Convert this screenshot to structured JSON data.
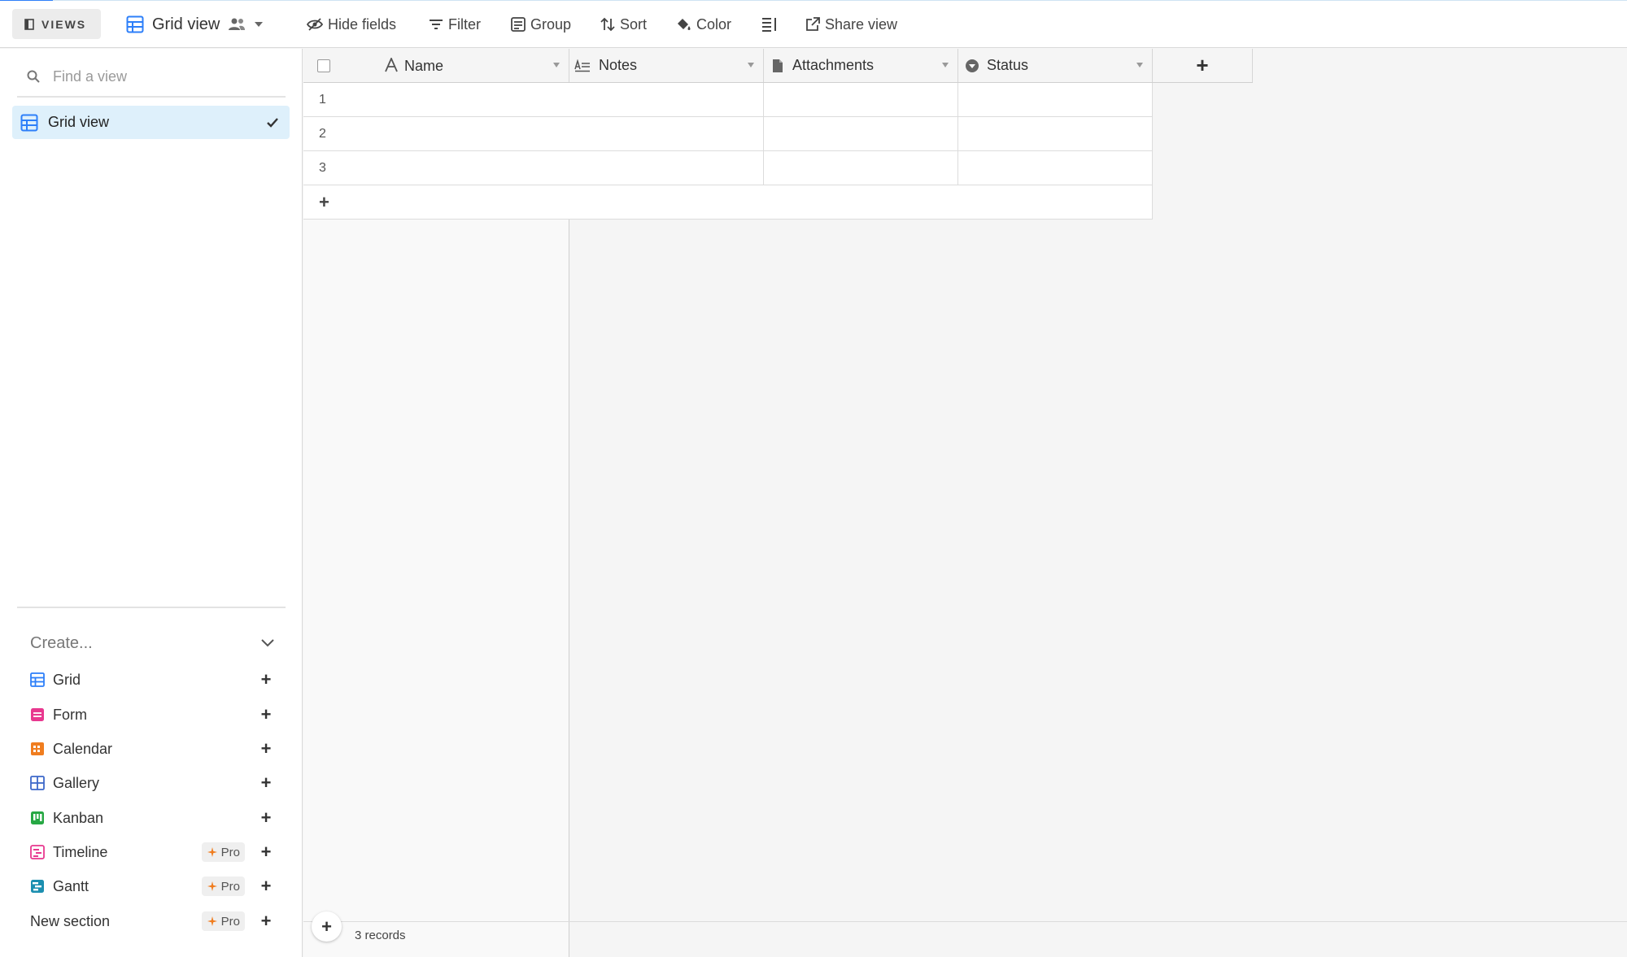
{
  "toolbar": {
    "views_label": "VIEWS",
    "current_view": "Grid view",
    "hide_fields": "Hide fields",
    "filter": "Filter",
    "group": "Group",
    "sort": "Sort",
    "color": "Color",
    "share_view": "Share view"
  },
  "sidebar": {
    "search_placeholder": "Find a view",
    "views": [
      {
        "label": "Grid view",
        "selected": true,
        "icon": "grid-icon"
      }
    ],
    "create": {
      "header": "Create...",
      "items": [
        {
          "label": "Grid",
          "icon": "grid-icon",
          "color": "#2d7ff9",
          "pro": false
        },
        {
          "label": "Form",
          "icon": "form-icon",
          "color": "#e8388f",
          "pro": false
        },
        {
          "label": "Calendar",
          "icon": "calendar-icon",
          "color": "#f07d1f",
          "pro": false
        },
        {
          "label": "Gallery",
          "icon": "gallery-icon",
          "color": "#3d68c9",
          "pro": false
        },
        {
          "label": "Kanban",
          "icon": "kanban-icon",
          "color": "#27a844",
          "pro": false
        },
        {
          "label": "Timeline",
          "icon": "timeline-icon",
          "color": "#e8388f",
          "pro": true
        },
        {
          "label": "Gantt",
          "icon": "gantt-icon",
          "color": "#1c8fb0",
          "pro": true
        },
        {
          "label": "New section",
          "icon": "",
          "color": "",
          "pro": true
        }
      ],
      "pro_label": "Pro"
    }
  },
  "grid": {
    "columns": [
      {
        "label": "Name",
        "icon": "text-a-icon"
      },
      {
        "label": "Notes",
        "icon": "long-text-icon"
      },
      {
        "label": "Attachments",
        "icon": "attachment-icon"
      },
      {
        "label": "Status",
        "icon": "status-icon"
      }
    ],
    "rows": [
      "1",
      "2",
      "3"
    ],
    "add_row": "+",
    "add_column": "+",
    "record_count": "3 records"
  },
  "colors": {
    "accent": "#2d7ff9",
    "selected_bg": "#def0fb"
  }
}
